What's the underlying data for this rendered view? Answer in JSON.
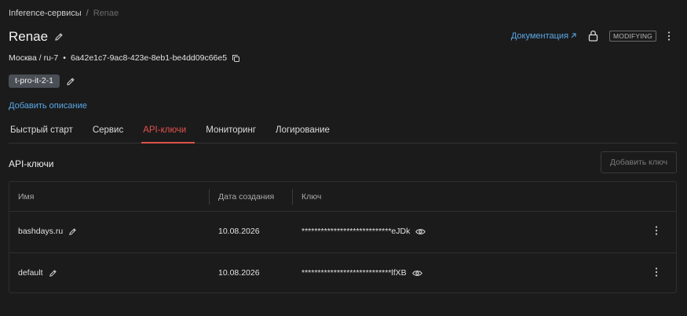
{
  "breadcrumb": {
    "parent": "Inference-сервисы",
    "separator": "/",
    "current": "Renae"
  },
  "header": {
    "title": "Renae",
    "doc_link": "Документация",
    "status": "MODIFYING"
  },
  "meta": {
    "location": "Москва / ru-7",
    "bullet": "•",
    "id": "6a42e1c7-9ac8-423e-8eb1-be4dd09c66e5"
  },
  "tag": "t-pro-it-2-1",
  "add_description": "Добавить описание",
  "tabs": [
    {
      "label": "Быстрый старт",
      "active": false
    },
    {
      "label": "Сервис",
      "active": false
    },
    {
      "label": "API-ключи",
      "active": true
    },
    {
      "label": "Мониторинг",
      "active": false
    },
    {
      "label": "Логирование",
      "active": false
    }
  ],
  "section": {
    "title": "API-ключи",
    "add_button": "Добавить ключ"
  },
  "table": {
    "columns": [
      "Имя",
      "Дата создания",
      "Ключ"
    ],
    "rows": [
      {
        "name": "bashdays.ru",
        "created": "10.08.2026",
        "key": "****************************eJDk"
      },
      {
        "name": "default",
        "created": "10.08.2026",
        "key": "****************************lfXB"
      }
    ]
  },
  "colors": {
    "accent": "#e0524a",
    "link": "#5aa9e6",
    "background": "#1b1b1c"
  }
}
